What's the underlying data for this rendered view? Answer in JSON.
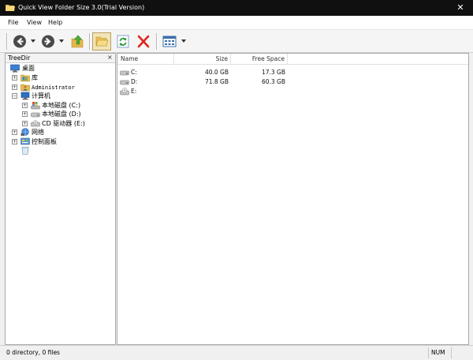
{
  "window": {
    "title": "Quick View Folder Size 3.0(Trial Version)",
    "close_glyph": "✕",
    "icon": "folder-icon"
  },
  "menu": [
    "File",
    "View",
    "Help"
  ],
  "toolbar": {
    "buttons": [
      {
        "name": "back-button",
        "icon": "back-arrow-icon"
      },
      {
        "name": "forward-button",
        "icon": "forward-arrow-icon"
      },
      {
        "name": "up-folder-button",
        "icon": "up-folder-icon"
      },
      {
        "name": "folders-button",
        "icon": "open-folder-icon",
        "pressed": true
      },
      {
        "name": "refresh-button",
        "icon": "refresh-icon"
      },
      {
        "name": "stop-button",
        "icon": "red-x-icon"
      },
      {
        "name": "view-mode-button",
        "icon": "details-view-icon"
      }
    ]
  },
  "left_pane": {
    "header": "TreeDir",
    "close_glyph": "×",
    "tree": [
      {
        "label": "桌面",
        "icon": "desktop-icon",
        "expander": ""
      },
      {
        "label": "库",
        "icon": "library-icon",
        "expander": "+"
      },
      {
        "label": "Administrator",
        "icon": "user-folder-icon",
        "expander": "+"
      },
      {
        "label": "计算机",
        "icon": "computer-icon",
        "expander": "−"
      },
      {
        "label": "本地磁盘 (C:)",
        "icon": "system-drive-icon",
        "expander": "+"
      },
      {
        "label": "本地磁盘 (D:)",
        "icon": "drive-icon",
        "expander": "+"
      },
      {
        "label": "CD 驱动器 (E:)",
        "icon": "cd-drive-icon",
        "expander": "+"
      },
      {
        "label": "网络",
        "icon": "network-icon",
        "expander": "+"
      },
      {
        "label": "控制面板",
        "icon": "control-panel-icon",
        "expander": "+"
      },
      {
        "label": "",
        "icon": "recycle-bin-icon",
        "expander": ""
      }
    ]
  },
  "table": {
    "columns": [
      "Name",
      "Size",
      "Free Space"
    ],
    "rows": [
      {
        "name": "C:",
        "size": "40.0 GB",
        "free": "17.3 GB",
        "icon": "drive-icon"
      },
      {
        "name": "D:",
        "size": "71.8 GB",
        "free": "60.3 GB",
        "icon": "drive-icon"
      },
      {
        "name": "E:",
        "size": "",
        "free": "",
        "icon": "cd-drive-icon"
      }
    ]
  },
  "status": {
    "text": "0 directory, 0 files",
    "num": "NUM"
  }
}
